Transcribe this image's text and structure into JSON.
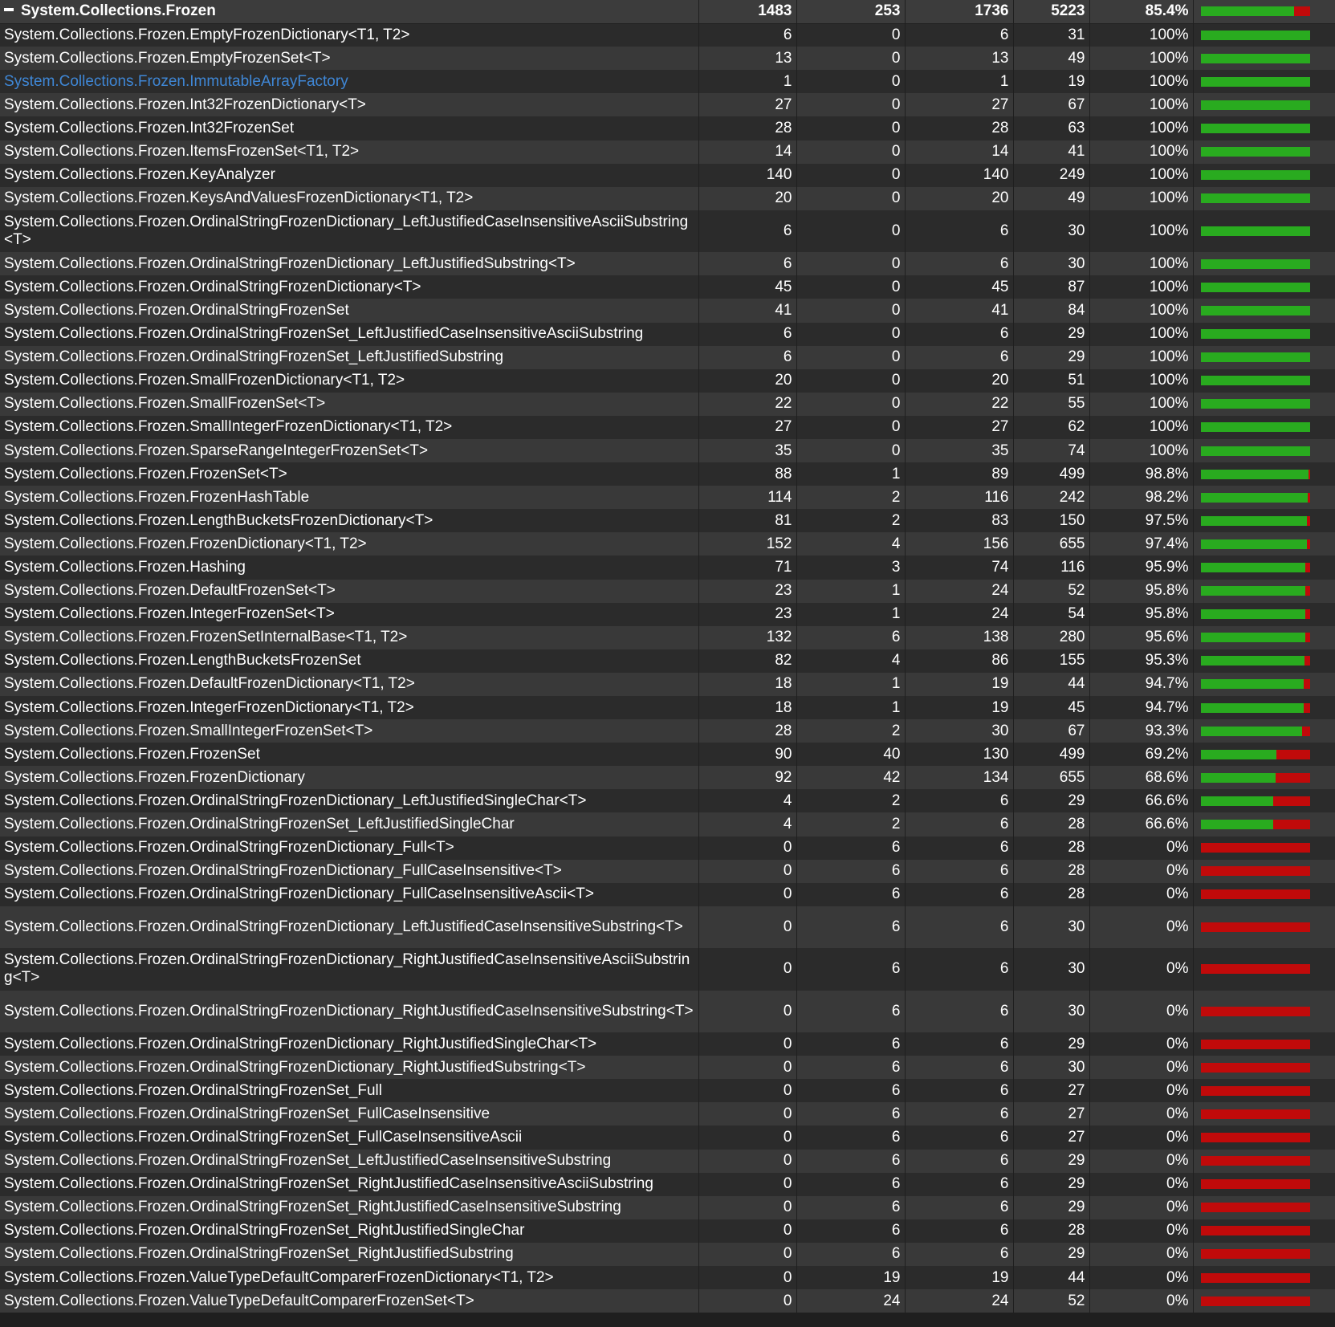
{
  "colors": {
    "covered": "#29ab1f",
    "uncovered": "#c10a0a",
    "link": "#3f87d6",
    "row_even": "#2b2b2b",
    "row_odd": "#393939",
    "text": "#ffffff"
  },
  "group": {
    "toggle_icon": "collapse-minus-icon",
    "name": "System.Collections.Frozen",
    "covered": "1483",
    "uncovered": "253",
    "coverable": "1736",
    "total": "5223",
    "percent": "85.4%",
    "ratio": 0.854
  },
  "rows": [
    {
      "name": "System.Collections.Frozen.EmptyFrozenDictionary<T1, T2>",
      "covered": "6",
      "uncovered": "0",
      "coverable": "6",
      "total": "31",
      "percent": "100%",
      "ratio": 1
    },
    {
      "name": "System.Collections.Frozen.EmptyFrozenSet<T>",
      "covered": "13",
      "uncovered": "0",
      "coverable": "13",
      "total": "49",
      "percent": "100%",
      "ratio": 1
    },
    {
      "name": "System.Collections.Frozen.ImmutableArrayFactory",
      "covered": "1",
      "uncovered": "0",
      "coverable": "1",
      "total": "19",
      "percent": "100%",
      "ratio": 1,
      "link": true
    },
    {
      "name": "System.Collections.Frozen.Int32FrozenDictionary<T>",
      "covered": "27",
      "uncovered": "0",
      "coverable": "27",
      "total": "67",
      "percent": "100%",
      "ratio": 1
    },
    {
      "name": "System.Collections.Frozen.Int32FrozenSet",
      "covered": "28",
      "uncovered": "0",
      "coverable": "28",
      "total": "63",
      "percent": "100%",
      "ratio": 1
    },
    {
      "name": "System.Collections.Frozen.ItemsFrozenSet<T1, T2>",
      "covered": "14",
      "uncovered": "0",
      "coverable": "14",
      "total": "41",
      "percent": "100%",
      "ratio": 1
    },
    {
      "name": "System.Collections.Frozen.KeyAnalyzer",
      "covered": "140",
      "uncovered": "0",
      "coverable": "140",
      "total": "249",
      "percent": "100%",
      "ratio": 1
    },
    {
      "name": "System.Collections.Frozen.KeysAndValuesFrozenDictionary<T1, T2>",
      "covered": "20",
      "uncovered": "0",
      "coverable": "20",
      "total": "49",
      "percent": "100%",
      "ratio": 1
    },
    {
      "name": "System.Collections.Frozen.OrdinalStringFrozenDictionary_LeftJustifiedCaseInsensitiveAsciiSubstring<T>",
      "covered": "6",
      "uncovered": "0",
      "coverable": "6",
      "total": "30",
      "percent": "100%",
      "ratio": 1,
      "tall": true
    },
    {
      "name": "System.Collections.Frozen.OrdinalStringFrozenDictionary_LeftJustifiedSubstring<T>",
      "covered": "6",
      "uncovered": "0",
      "coverable": "6",
      "total": "30",
      "percent": "100%",
      "ratio": 1
    },
    {
      "name": "System.Collections.Frozen.OrdinalStringFrozenDictionary<T>",
      "covered": "45",
      "uncovered": "0",
      "coverable": "45",
      "total": "87",
      "percent": "100%",
      "ratio": 1
    },
    {
      "name": "System.Collections.Frozen.OrdinalStringFrozenSet",
      "covered": "41",
      "uncovered": "0",
      "coverable": "41",
      "total": "84",
      "percent": "100%",
      "ratio": 1
    },
    {
      "name": "System.Collections.Frozen.OrdinalStringFrozenSet_LeftJustifiedCaseInsensitiveAsciiSubstring",
      "covered": "6",
      "uncovered": "0",
      "coverable": "6",
      "total": "29",
      "percent": "100%",
      "ratio": 1
    },
    {
      "name": "System.Collections.Frozen.OrdinalStringFrozenSet_LeftJustifiedSubstring",
      "covered": "6",
      "uncovered": "0",
      "coverable": "6",
      "total": "29",
      "percent": "100%",
      "ratio": 1
    },
    {
      "name": "System.Collections.Frozen.SmallFrozenDictionary<T1, T2>",
      "covered": "20",
      "uncovered": "0",
      "coverable": "20",
      "total": "51",
      "percent": "100%",
      "ratio": 1
    },
    {
      "name": "System.Collections.Frozen.SmallFrozenSet<T>",
      "covered": "22",
      "uncovered": "0",
      "coverable": "22",
      "total": "55",
      "percent": "100%",
      "ratio": 1
    },
    {
      "name": "System.Collections.Frozen.SmallIntegerFrozenDictionary<T1, T2>",
      "covered": "27",
      "uncovered": "0",
      "coverable": "27",
      "total": "62",
      "percent": "100%",
      "ratio": 1
    },
    {
      "name": "System.Collections.Frozen.SparseRangeIntegerFrozenSet<T>",
      "covered": "35",
      "uncovered": "0",
      "coverable": "35",
      "total": "74",
      "percent": "100%",
      "ratio": 1
    },
    {
      "name": "System.Collections.Frozen.FrozenSet<T>",
      "covered": "88",
      "uncovered": "1",
      "coverable": "89",
      "total": "499",
      "percent": "98.8%",
      "ratio": 0.988
    },
    {
      "name": "System.Collections.Frozen.FrozenHashTable",
      "covered": "114",
      "uncovered": "2",
      "coverable": "116",
      "total": "242",
      "percent": "98.2%",
      "ratio": 0.982
    },
    {
      "name": "System.Collections.Frozen.LengthBucketsFrozenDictionary<T>",
      "covered": "81",
      "uncovered": "2",
      "coverable": "83",
      "total": "150",
      "percent": "97.5%",
      "ratio": 0.975
    },
    {
      "name": "System.Collections.Frozen.FrozenDictionary<T1, T2>",
      "covered": "152",
      "uncovered": "4",
      "coverable": "156",
      "total": "655",
      "percent": "97.4%",
      "ratio": 0.974
    },
    {
      "name": "System.Collections.Frozen.Hashing",
      "covered": "71",
      "uncovered": "3",
      "coverable": "74",
      "total": "116",
      "percent": "95.9%",
      "ratio": 0.959
    },
    {
      "name": "System.Collections.Frozen.DefaultFrozenSet<T>",
      "covered": "23",
      "uncovered": "1",
      "coverable": "24",
      "total": "52",
      "percent": "95.8%",
      "ratio": 0.958
    },
    {
      "name": "System.Collections.Frozen.IntegerFrozenSet<T>",
      "covered": "23",
      "uncovered": "1",
      "coverable": "24",
      "total": "54",
      "percent": "95.8%",
      "ratio": 0.958
    },
    {
      "name": "System.Collections.Frozen.FrozenSetInternalBase<T1, T2>",
      "covered": "132",
      "uncovered": "6",
      "coverable": "138",
      "total": "280",
      "percent": "95.6%",
      "ratio": 0.956
    },
    {
      "name": "System.Collections.Frozen.LengthBucketsFrozenSet",
      "covered": "82",
      "uncovered": "4",
      "coverable": "86",
      "total": "155",
      "percent": "95.3%",
      "ratio": 0.953
    },
    {
      "name": "System.Collections.Frozen.DefaultFrozenDictionary<T1, T2>",
      "covered": "18",
      "uncovered": "1",
      "coverable": "19",
      "total": "44",
      "percent": "94.7%",
      "ratio": 0.947
    },
    {
      "name": "System.Collections.Frozen.IntegerFrozenDictionary<T1, T2>",
      "covered": "18",
      "uncovered": "1",
      "coverable": "19",
      "total": "45",
      "percent": "94.7%",
      "ratio": 0.947
    },
    {
      "name": "System.Collections.Frozen.SmallIntegerFrozenSet<T>",
      "covered": "28",
      "uncovered": "2",
      "coverable": "30",
      "total": "67",
      "percent": "93.3%",
      "ratio": 0.933
    },
    {
      "name": "System.Collections.Frozen.FrozenSet",
      "covered": "90",
      "uncovered": "40",
      "coverable": "130",
      "total": "499",
      "percent": "69.2%",
      "ratio": 0.692
    },
    {
      "name": "System.Collections.Frozen.FrozenDictionary",
      "covered": "92",
      "uncovered": "42",
      "coverable": "134",
      "total": "655",
      "percent": "68.6%",
      "ratio": 0.686
    },
    {
      "name": "System.Collections.Frozen.OrdinalStringFrozenDictionary_LeftJustifiedSingleChar<T>",
      "covered": "4",
      "uncovered": "2",
      "coverable": "6",
      "total": "29",
      "percent": "66.6%",
      "ratio": 0.666
    },
    {
      "name": "System.Collections.Frozen.OrdinalStringFrozenSet_LeftJustifiedSingleChar",
      "covered": "4",
      "uncovered": "2",
      "coverable": "6",
      "total": "28",
      "percent": "66.6%",
      "ratio": 0.666
    },
    {
      "name": "System.Collections.Frozen.OrdinalStringFrozenDictionary_Full<T>",
      "covered": "0",
      "uncovered": "6",
      "coverable": "6",
      "total": "28",
      "percent": "0%",
      "ratio": 0
    },
    {
      "name": "System.Collections.Frozen.OrdinalStringFrozenDictionary_FullCaseInsensitive<T>",
      "covered": "0",
      "uncovered": "6",
      "coverable": "6",
      "total": "28",
      "percent": "0%",
      "ratio": 0
    },
    {
      "name": "System.Collections.Frozen.OrdinalStringFrozenDictionary_FullCaseInsensitiveAscii<T>",
      "covered": "0",
      "uncovered": "6",
      "coverable": "6",
      "total": "28",
      "percent": "0%",
      "ratio": 0
    },
    {
      "name": "System.Collections.Frozen.OrdinalStringFrozenDictionary_LeftJustifiedCaseInsensitiveSubstring<T>",
      "covered": "0",
      "uncovered": "6",
      "coverable": "6",
      "total": "30",
      "percent": "0%",
      "ratio": 0,
      "tall": true
    },
    {
      "name": "System.Collections.Frozen.OrdinalStringFrozenDictionary_RightJustifiedCaseInsensitiveAsciiSubstring<T>",
      "covered": "0",
      "uncovered": "6",
      "coverable": "6",
      "total": "30",
      "percent": "0%",
      "ratio": 0,
      "tall": true
    },
    {
      "name": "System.Collections.Frozen.OrdinalStringFrozenDictionary_RightJustifiedCaseInsensitiveSubstring<T>",
      "covered": "0",
      "uncovered": "6",
      "coverable": "6",
      "total": "30",
      "percent": "0%",
      "ratio": 0,
      "tall": true
    },
    {
      "name": "System.Collections.Frozen.OrdinalStringFrozenDictionary_RightJustifiedSingleChar<T>",
      "covered": "0",
      "uncovered": "6",
      "coverable": "6",
      "total": "29",
      "percent": "0%",
      "ratio": 0
    },
    {
      "name": "System.Collections.Frozen.OrdinalStringFrozenDictionary_RightJustifiedSubstring<T>",
      "covered": "0",
      "uncovered": "6",
      "coverable": "6",
      "total": "30",
      "percent": "0%",
      "ratio": 0
    },
    {
      "name": "System.Collections.Frozen.OrdinalStringFrozenSet_Full",
      "covered": "0",
      "uncovered": "6",
      "coverable": "6",
      "total": "27",
      "percent": "0%",
      "ratio": 0
    },
    {
      "name": "System.Collections.Frozen.OrdinalStringFrozenSet_FullCaseInsensitive",
      "covered": "0",
      "uncovered": "6",
      "coverable": "6",
      "total": "27",
      "percent": "0%",
      "ratio": 0
    },
    {
      "name": "System.Collections.Frozen.OrdinalStringFrozenSet_FullCaseInsensitiveAscii",
      "covered": "0",
      "uncovered": "6",
      "coverable": "6",
      "total": "27",
      "percent": "0%",
      "ratio": 0
    },
    {
      "name": "System.Collections.Frozen.OrdinalStringFrozenSet_LeftJustifiedCaseInsensitiveSubstring",
      "covered": "0",
      "uncovered": "6",
      "coverable": "6",
      "total": "29",
      "percent": "0%",
      "ratio": 0
    },
    {
      "name": "System.Collections.Frozen.OrdinalStringFrozenSet_RightJustifiedCaseInsensitiveAsciiSubstring",
      "covered": "0",
      "uncovered": "6",
      "coverable": "6",
      "total": "29",
      "percent": "0%",
      "ratio": 0
    },
    {
      "name": "System.Collections.Frozen.OrdinalStringFrozenSet_RightJustifiedCaseInsensitiveSubstring",
      "covered": "0",
      "uncovered": "6",
      "coverable": "6",
      "total": "29",
      "percent": "0%",
      "ratio": 0
    },
    {
      "name": "System.Collections.Frozen.OrdinalStringFrozenSet_RightJustifiedSingleChar",
      "covered": "0",
      "uncovered": "6",
      "coverable": "6",
      "total": "28",
      "percent": "0%",
      "ratio": 0
    },
    {
      "name": "System.Collections.Frozen.OrdinalStringFrozenSet_RightJustifiedSubstring",
      "covered": "0",
      "uncovered": "6",
      "coverable": "6",
      "total": "29",
      "percent": "0%",
      "ratio": 0
    },
    {
      "name": "System.Collections.Frozen.ValueTypeDefaultComparerFrozenDictionary<T1, T2>",
      "covered": "0",
      "uncovered": "19",
      "coverable": "19",
      "total": "44",
      "percent": "0%",
      "ratio": 0
    },
    {
      "name": "System.Collections.Frozen.ValueTypeDefaultComparerFrozenSet<T>",
      "covered": "0",
      "uncovered": "24",
      "coverable": "24",
      "total": "52",
      "percent": "0%",
      "ratio": 0
    }
  ]
}
